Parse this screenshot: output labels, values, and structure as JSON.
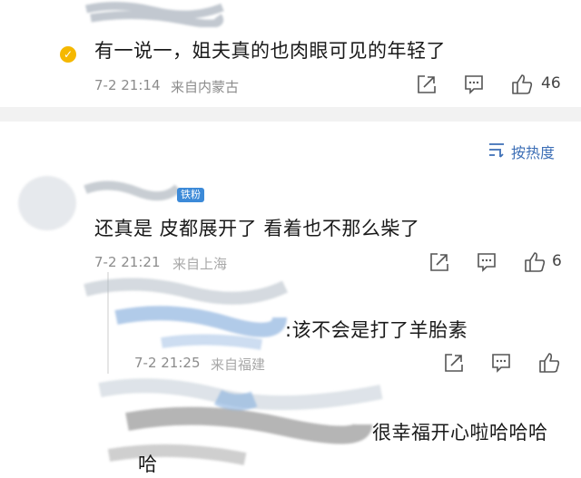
{
  "comment1": {
    "text": "有一说一，姐夫真的也肉眼可见的年轻了",
    "date": "7-2 21:14",
    "location": "来自内蒙古",
    "likes": "46",
    "badge_color": "#f5b800"
  },
  "sort": {
    "label": "按热度",
    "icon": "sort-lines-icon"
  },
  "comment2": {
    "badge": "铁粉",
    "text": "还真是 皮都展开了 看着也不那么柴了",
    "date": "7-2 21:21",
    "location": "来自上海",
    "likes": "6"
  },
  "reply1": {
    "text": ":该不会是打了羊胎素",
    "date": "7-2 21:25",
    "location": "来自福建"
  },
  "reply2": {
    "text": "很幸福开心啦哈哈哈",
    "text_wrap": "哈"
  },
  "colors": {
    "accent": "#3d6fb6",
    "meta": "#8c8c8c",
    "divider": "#f2f2f2"
  }
}
